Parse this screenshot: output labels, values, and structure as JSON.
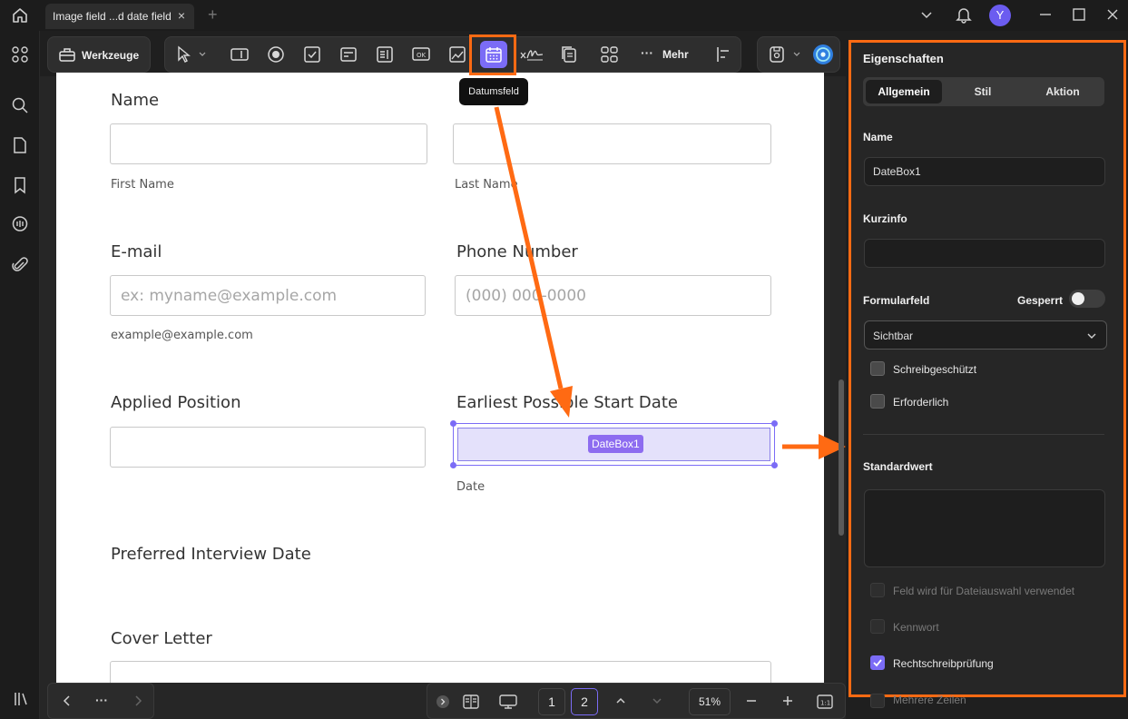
{
  "titlebar": {
    "tab_title": "Image field ...d date field",
    "avatar_letter": "Y"
  },
  "toolbar": {
    "tools_label": "Werkzeuge",
    "more_label": "Mehr",
    "tooltip": "Datumsfeld"
  },
  "form": {
    "name_label": "Name",
    "first_name_sub": "First Name",
    "last_name_sub": "Last Name",
    "email_label": "E-mail",
    "email_placeholder": "ex: myname@example.com",
    "email_sub": "example@example.com",
    "phone_label": "Phone Number",
    "phone_placeholder": "(000) 000-0000",
    "position_label": "Applied Position",
    "start_date_label": "Earliest Possible Start Date",
    "date_box_tag": "DateBox1",
    "date_sub": "Date",
    "interview_label": "Preferred Interview Date",
    "cover_label": "Cover Letter"
  },
  "panel": {
    "title": "Eigenschaften",
    "tabs": [
      "Allgemein",
      "Stil",
      "Aktion"
    ],
    "active_tab": "Allgemein",
    "name_label": "Name",
    "name_value": "DateBox1",
    "tooltip_label": "Kurzinfo",
    "tooltip_value": "",
    "form_field_label": "Formularfeld",
    "locked_label": "Gesperrt",
    "locked": false,
    "visibility_value": "Sichtbar",
    "readonly_label": "Schreibgeschützt",
    "readonly": false,
    "required_label": "Erforderlich",
    "required": false,
    "default_label": "Standardwert",
    "default_value": "",
    "file_select_label": "Feld wird für Dateiauswahl verwendet",
    "password_label": "Kennwort",
    "spellcheck_label": "Rechtschreibprüfung",
    "spellcheck": true,
    "multiline_label": "Mehrere Zeilen"
  },
  "bottombar": {
    "page1": "1",
    "page2": "2",
    "zoom": "51%",
    "more_dots": "···"
  },
  "colors": {
    "accent": "#7b6cf6",
    "highlight": "#ff6a13",
    "panel_bg": "#262626"
  }
}
